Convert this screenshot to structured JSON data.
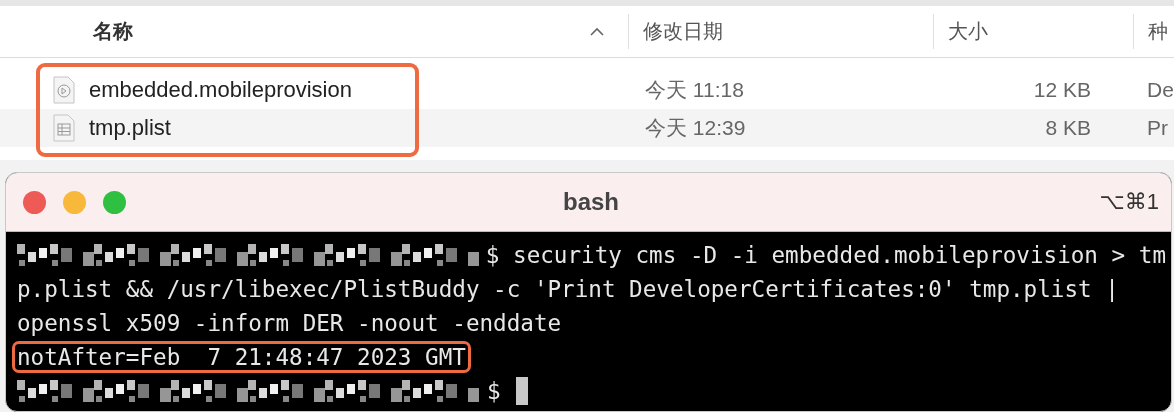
{
  "finder": {
    "columns": [
      {
        "label": "名称",
        "sorted": true
      },
      {
        "label": "修改日期",
        "sorted": false
      },
      {
        "label": "大小",
        "sorted": false
      },
      {
        "label": "种",
        "sorted": false
      }
    ],
    "outlined": true,
    "files": [
      {
        "kind": "provision",
        "name": "embedded.mobileprovision",
        "modified": "今天 11:18",
        "size": "12 KB",
        "column_4": "De"
      },
      {
        "kind": "plist",
        "name": "tmp.plist",
        "modified": "今天 12:39",
        "size": "8 KB",
        "column_4": "Pr"
      }
    ]
  },
  "terminal": {
    "title": "bash",
    "shortcut": "⌥⌘1",
    "lines": [
      {
        "kind": "prompt",
        "text": "$ security cms -D -i embedded.mobileprovision > tm",
        "highlighted": false,
        "cursor": false
      },
      {
        "kind": "output",
        "text": "p.plist && /usr/libexec/PlistBuddy -c 'Print DeveloperCertificates:0' tmp.plist |",
        "highlighted": false,
        "cursor": false
      },
      {
        "kind": "output",
        "text": "openssl x509 -inform DER -noout -enddate",
        "highlighted": false,
        "cursor": false
      },
      {
        "kind": "output",
        "text": "notAfter=Feb  7 21:48:47 2023 GMT",
        "highlighted": true,
        "cursor": false
      },
      {
        "kind": "prompt",
        "text": "$",
        "highlighted": false,
        "cursor": true
      }
    ]
  }
}
